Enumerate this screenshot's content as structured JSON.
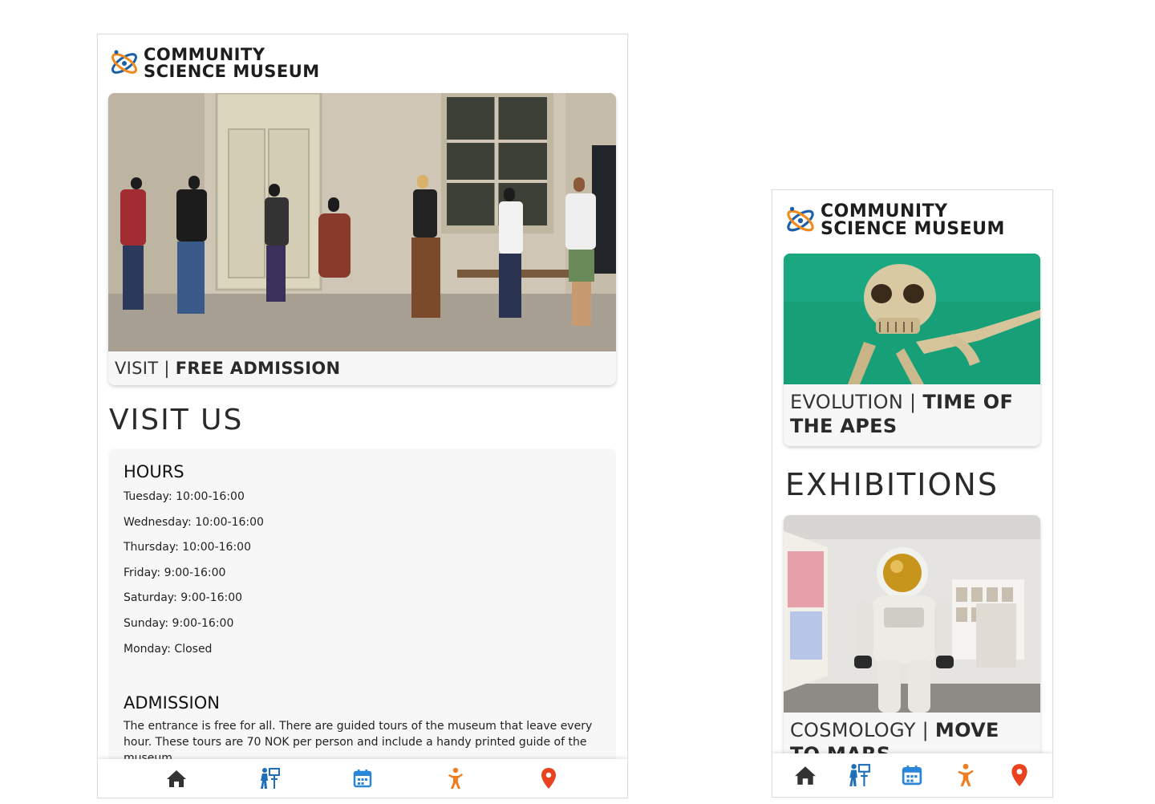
{
  "brand": {
    "line1": "COMMUNITY",
    "line2": "SCIENCE MUSEUM"
  },
  "left_screen": {
    "hero_card": {
      "caption_prefix": "VISIT | ",
      "caption_strong": "FREE ADMISSION"
    },
    "section_title": "VISIT US",
    "hours": {
      "heading": "HOURS",
      "items": [
        "Tuesday: 10:00-16:00",
        "Wednesday: 10:00-16:00",
        "Thursday: 10:00-16:00",
        "Friday: 9:00-16:00",
        "Saturday: 9:00-16:00",
        "Sunday: 9:00-16:00",
        "Monday: Closed"
      ]
    },
    "admission": {
      "heading": "ADMISSION",
      "text": "The entrance is free for all. There are guided tours of the museum that leave every hour. These tours are 70 NOK per person and include a handy printed guide of the museum."
    }
  },
  "right_screen": {
    "top_card": {
      "caption_prefix": "EVOLUTION | ",
      "caption_strong": "TIME OF THE APES"
    },
    "section_title": "EXHIBITIONS",
    "second_card": {
      "caption_prefix": "COSMOLOGY | ",
      "caption_strong": "MOVE TO MARS"
    }
  },
  "bottom_nav": {
    "icons": [
      "home-icon",
      "guide-icon",
      "calendar-icon",
      "activity-icon",
      "location-pin-icon"
    ]
  },
  "colors": {
    "nav_dark": "#333333",
    "nav_blue": "#1f6fb8",
    "nav_calendar": "#2a86d8",
    "nav_orange": "#ef7d22",
    "nav_red": "#e8431e",
    "logo_blue": "#1a5fa8",
    "logo_orange": "#f08a1c"
  }
}
